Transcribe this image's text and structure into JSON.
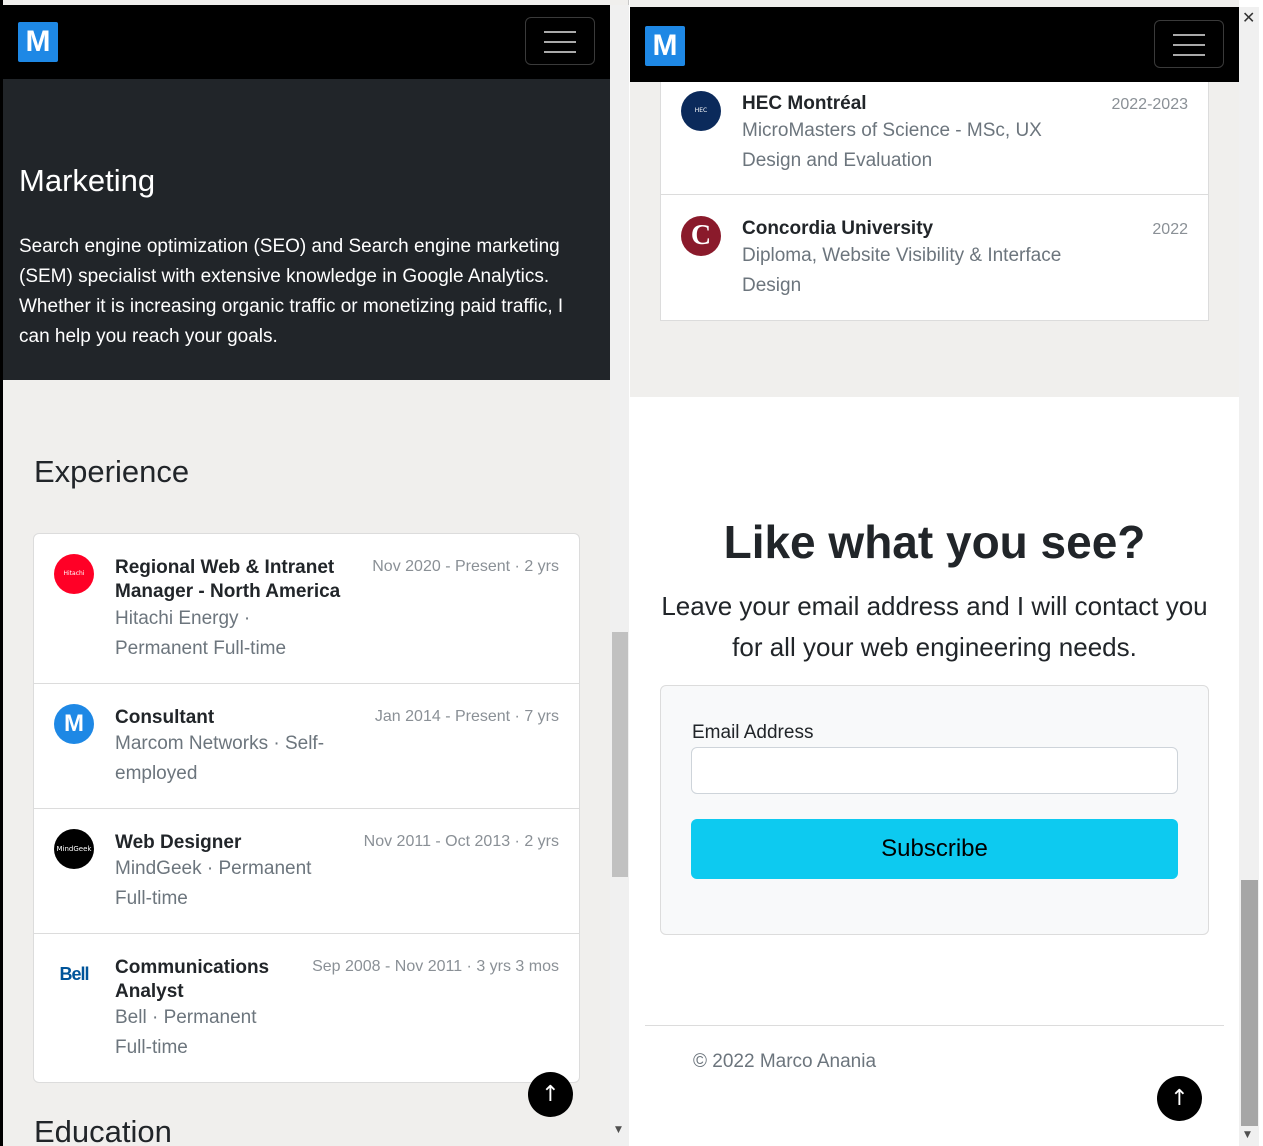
{
  "left": {
    "logo_letter": "M",
    "hero": {
      "title": "Marketing",
      "text": "Search engine optimization (SEO) and Search engine marketing (SEM) specialist with extensive knowledge in Google Analytics. Whether it is increasing organic traffic or monetizing paid traffic, I can help you reach your goals."
    },
    "experience": {
      "title": "Experience",
      "items": [
        {
          "role": "Regional Web & Intranet Manager - North America",
          "company": "Hitachi Energy · Permanent Full-time",
          "date": "Nov 2020 - Present · 2 yrs",
          "logo_text": "Hitachi Energy",
          "logo_color": "#ff0026"
        },
        {
          "role": "Consultant",
          "company": "Marcom Networks · Self-employed",
          "date": "Jan 2014 - Present · 7 yrs",
          "logo_text": "M",
          "logo_color": "#1e88e5"
        },
        {
          "role": "Web Designer",
          "company": "MindGeek · Permanent Full-time",
          "date": "Nov 2011 - Oct 2013 · 2 yrs",
          "logo_text": "MindGeek",
          "logo_color": "#000000"
        },
        {
          "role": "Communications Analyst",
          "company": "Bell · Permanent Full-time",
          "date": "Sep 2008 - Nov 2011 · 3 yrs 3 mos",
          "logo_text": "Bell",
          "logo_color": "#00549a"
        }
      ]
    },
    "education_title": "Education",
    "back_to_top": "↑"
  },
  "right": {
    "logo_letter": "M",
    "education": [
      {
        "school": "HEC Montréal",
        "degree": "MicroMasters of Science - MSc, UX Design and Evaluation",
        "years": "2022-2023",
        "logo_text": "HEC MONTRÉAL",
        "logo_color": "#0b2a5b"
      },
      {
        "school": "Concordia University",
        "degree": "Diploma, Website Visibility & Interface Design",
        "years": "2022",
        "logo_text": "C",
        "logo_color": "#8a1a2b"
      }
    ],
    "cta": {
      "title": "Like what you see?",
      "text": "Leave your email address and I will contact you for all your web engineering needs.",
      "email_label": "Email Address",
      "email_value": "",
      "subscribe_label": "Subscribe"
    },
    "footer": "© 2022 Marco Anania",
    "back_to_top": "↑",
    "close_glyph": "✕"
  }
}
